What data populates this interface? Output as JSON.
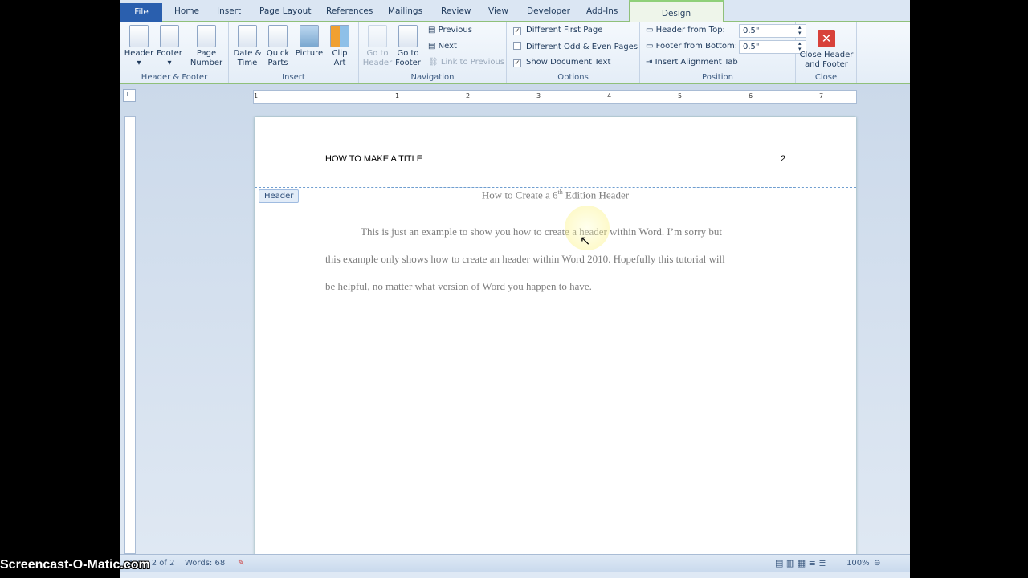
{
  "tabs": [
    "File",
    "Home",
    "Insert",
    "Page Layout",
    "References",
    "Mailings",
    "Review",
    "View",
    "Developer",
    "Add-Ins",
    "Design"
  ],
  "groups": {
    "hf": {
      "label": "Header & Footer",
      "header": "Header",
      "footer": "Footer",
      "page_number": "Page Number"
    },
    "insert": {
      "label": "Insert",
      "date": "Date & Time",
      "quick": "Quick Parts",
      "picture": "Picture",
      "clip": "Clip Art"
    },
    "nav": {
      "label": "Navigation",
      "go_header": "Go to Header",
      "go_footer": "Go to Footer",
      "previous": "Previous",
      "next": "Next",
      "link": "Link to Previous"
    },
    "options": {
      "label": "Options",
      "first": "Different First Page",
      "odd": "Different Odd & Even Pages",
      "show": "Show Document Text",
      "first_checked": true,
      "odd_checked": false,
      "show_checked": true
    },
    "position": {
      "label": "Position",
      "top_label": "Header from Top:",
      "top_value": "0.5\"",
      "bottom_label": "Footer from Bottom:",
      "bottom_value": "0.5\"",
      "align": "Insert Alignment Tab"
    },
    "close": {
      "label": "Close",
      "button": "Close Header and Footer"
    }
  },
  "ruler_numbers": [
    "1",
    "1",
    "2",
    "3",
    "4",
    "5",
    "6",
    "7"
  ],
  "document": {
    "header_left": "HOW TO MAKE A TITLE",
    "header_page": "2",
    "header_tag": "Header",
    "title_pre": "How to Create a 6",
    "title_sup": "th",
    "title_post": " Edition Header",
    "lines": [
      "This is just an example to show you how to create a header within Word.  I’m sorry but",
      "this example only shows how to create an header within Word 2010.  Hopefully this tutorial will",
      "be helpful, no matter what version  of Word you happen to have."
    ]
  },
  "status": {
    "page": "Page: 2 of 2",
    "words": "Words: 68",
    "zoom": "100%"
  },
  "watermark": "Screencast-O-Matic.com"
}
